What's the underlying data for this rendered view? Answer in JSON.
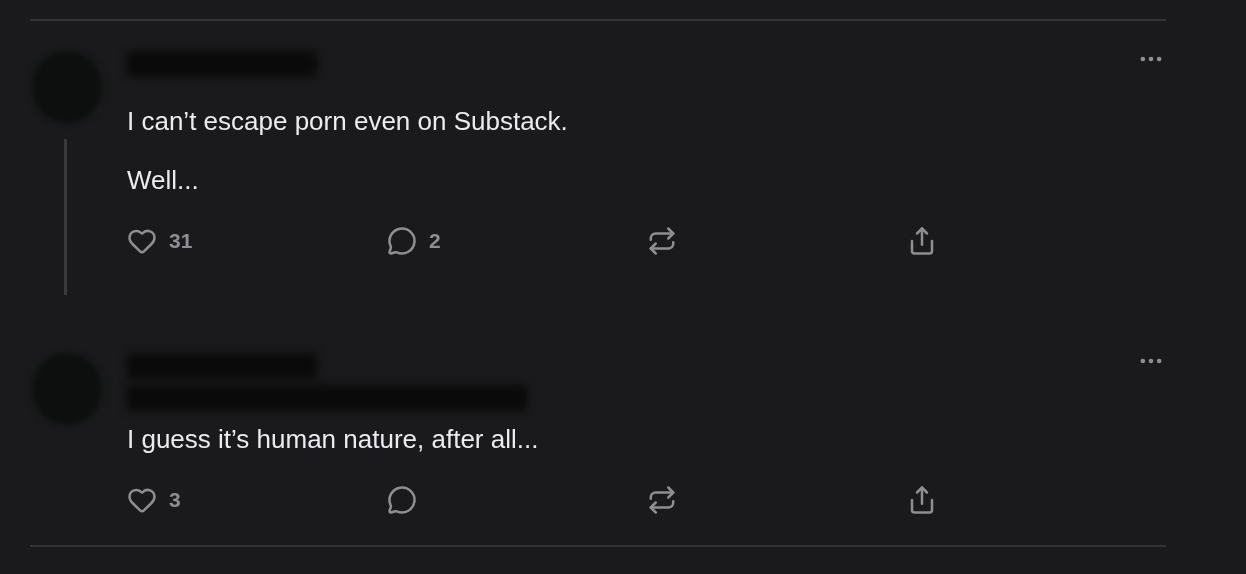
{
  "comments": [
    {
      "threaded": true,
      "kind": "name_only",
      "paragraphs": [
        "I can’t escape porn even on Substack.",
        "Well..."
      ],
      "actions": [
        {
          "kind": "like",
          "count": "31"
        },
        {
          "kind": "reply",
          "count": "2"
        },
        {
          "kind": "restack"
        },
        {
          "kind": "share"
        }
      ]
    },
    {
      "threaded": false,
      "kind": "name_and_bio",
      "paragraphs": [
        "I guess it’s human nature, after all..."
      ],
      "actions": [
        {
          "kind": "like",
          "count": "3"
        },
        {
          "kind": "reply"
        },
        {
          "kind": "restack"
        },
        {
          "kind": "share"
        }
      ]
    }
  ]
}
